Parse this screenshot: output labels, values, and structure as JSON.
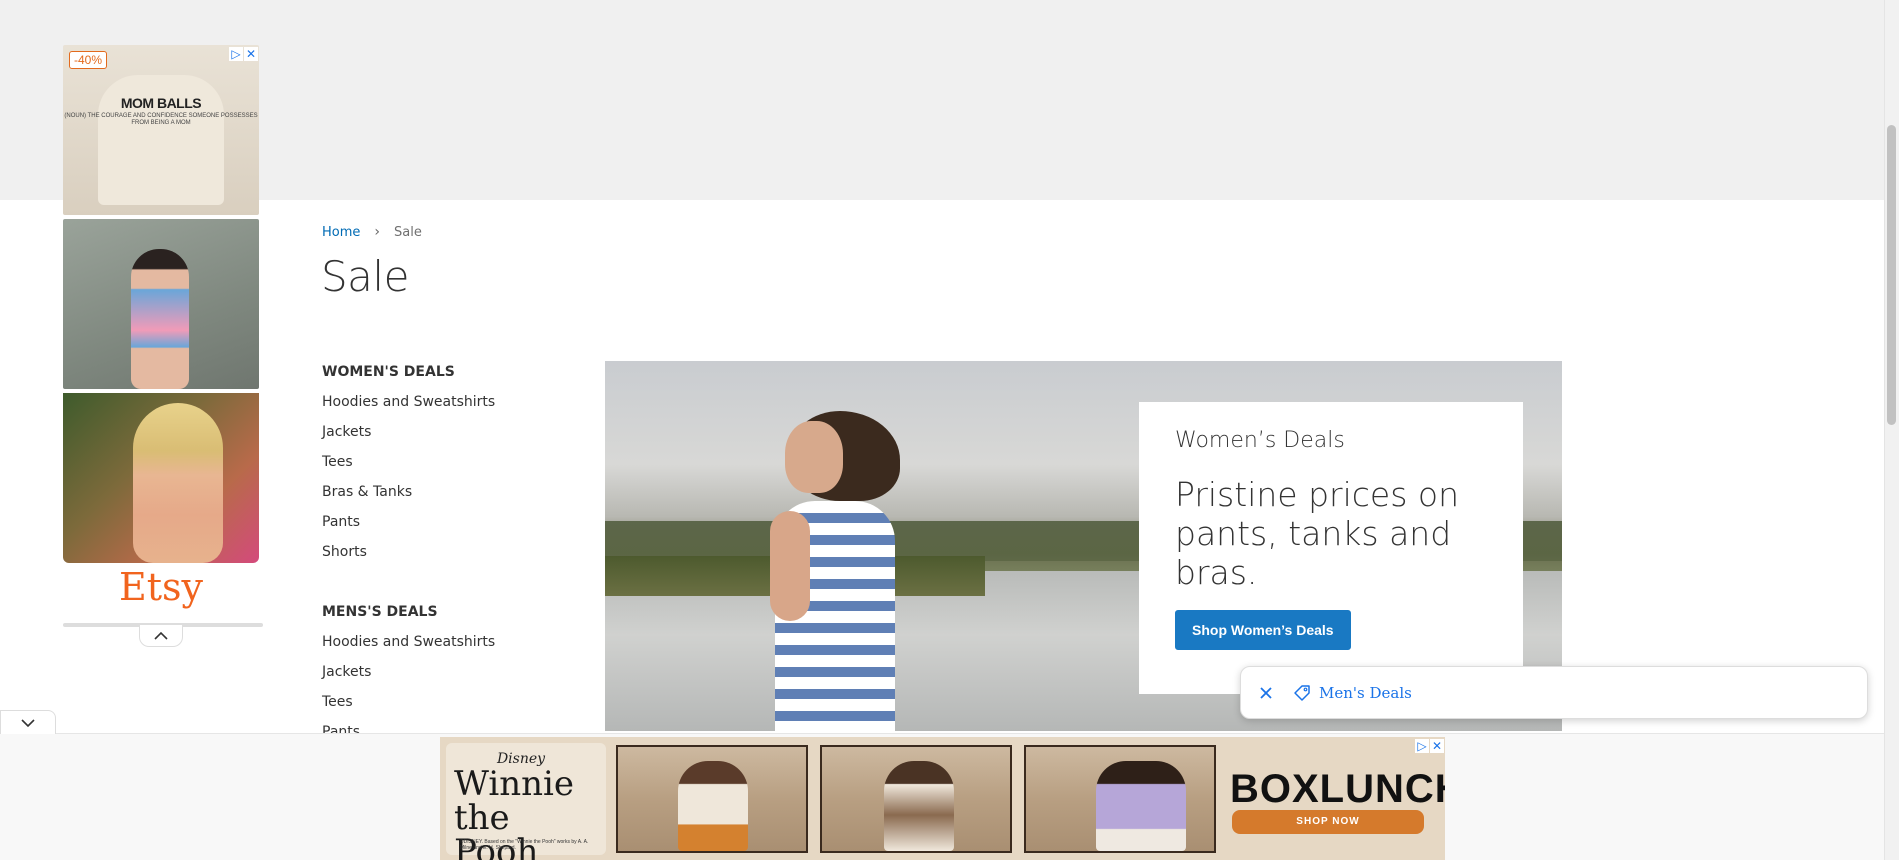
{
  "left_ad": {
    "discount_badge": "-40%",
    "sweater_text": "MOM BALLS",
    "sweater_subtext": "(NOUN) THE COURAGE AND CONFIDENCE SOMEONE POSSESSES FROM BEING A MOM",
    "brand": "Etsy",
    "adchoices_icon": "play-triangle-icon",
    "close_icon": "close-icon"
  },
  "breadcrumb": {
    "home": "Home",
    "separator": "›",
    "current": "Sale"
  },
  "page_title": "Sale",
  "nav": {
    "womens_heading": "WOMEN'S DEALS",
    "womens_items": [
      "Hoodies and Sweatshirts",
      "Jackets",
      "Tees",
      "Bras & Tanks",
      "Pants",
      "Shorts"
    ],
    "mens_heading": "MENS'S DEALS",
    "mens_items": [
      "Hoodies and Sweatshirts",
      "Jackets",
      "Tees",
      "Pants"
    ]
  },
  "promo": {
    "kicker": "Women’s Deals",
    "title": "Pristine prices on pants, tanks and bras.",
    "button": "Shop Women’s Deals"
  },
  "floating_chip": {
    "label": "Men's Deals"
  },
  "bottom_ad": {
    "disney": "Disney",
    "title": "Winnie the Pooh",
    "fineprint": "©DISNEY. Based on the \"Winnie the Pooh\" works by A. A. Milne and E. H. Shepard.",
    "brand": "BOXLUNCH",
    "cta": "SHOP NOW"
  },
  "colors": {
    "link": "#006bb4",
    "button": "#1979c3",
    "etsy": "#f1641e",
    "chip_text": "#1a73e8"
  }
}
